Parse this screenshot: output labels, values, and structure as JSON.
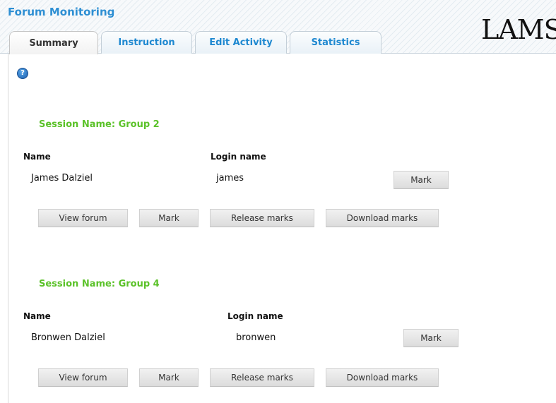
{
  "app": {
    "title": "Forum Monitoring",
    "logo_text": "LAMS"
  },
  "tabs": [
    {
      "label": "Summary",
      "active": true
    },
    {
      "label": "Instruction",
      "active": false
    },
    {
      "label": "Edit Activity",
      "active": false
    },
    {
      "label": "Statistics",
      "active": false
    }
  ],
  "help_icon": "?",
  "sessions": [
    {
      "title": "Session Name: Group 2",
      "headers": {
        "name": "Name",
        "login": "Login name"
      },
      "rows": [
        {
          "name": "James Dalziel",
          "login": "james",
          "mark_label": "Mark"
        }
      ],
      "actions": {
        "view_forum": "View forum",
        "mark": "Mark",
        "release_marks": "Release marks",
        "download_marks": "Download marks"
      }
    },
    {
      "title": "Session Name: Group 4",
      "headers": {
        "name": "Name",
        "login": "Login name"
      },
      "rows": [
        {
          "name": "Bronwen Dalziel",
          "login": "bronwen",
          "mark_label": "Mark"
        }
      ],
      "actions": {
        "view_forum": "View forum",
        "mark": "Mark",
        "release_marks": "Release marks",
        "download_marks": "Download marks"
      }
    }
  ],
  "colors": {
    "title": "#2e8fd3",
    "session": "#5bc229",
    "tab_text": "#1e88d0"
  }
}
